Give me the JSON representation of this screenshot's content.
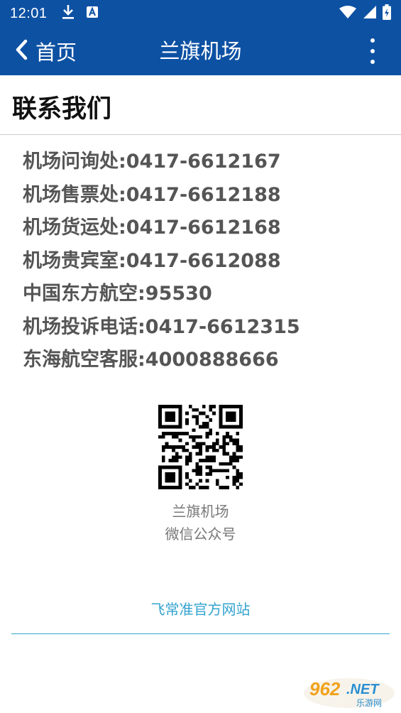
{
  "status_bar": {
    "time": "12:01",
    "icons": [
      "download-icon",
      "keyboard-icon",
      "wifi-icon",
      "signal-icon",
      "battery-icon"
    ]
  },
  "app_bar": {
    "back_label": "首页",
    "title": "兰旗机场",
    "background_color": "#0d51a3"
  },
  "page": {
    "section_title": "联系我们",
    "contacts": [
      "机场问询处:0417-6612167",
      "机场售票处:0417-6612188",
      "机场货运处:0417-6612168",
      "机场贵宾室:0417-6612088",
      "中国东方航空:95530",
      "机场投诉电话:0417-6612315",
      "东海航空客服:4000888666"
    ],
    "qr_caption_line1": "兰旗机场",
    "qr_caption_line2": "微信公众号",
    "official_link": "飞常准官方网站",
    "link_color": "#33a3cf"
  },
  "watermark": {
    "top": "962.NET",
    "bottom": "乐游网"
  }
}
